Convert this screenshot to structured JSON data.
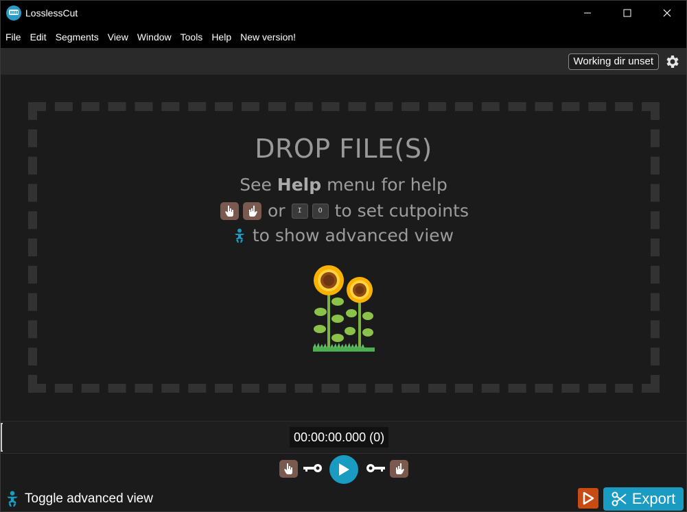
{
  "window": {
    "title": "LosslessCut",
    "minimize_icon": "minimize-icon",
    "maximize_icon": "maximize-icon",
    "close_icon": "close-icon"
  },
  "menu": [
    "File",
    "Edit",
    "Segments",
    "View",
    "Window",
    "Tools",
    "Help",
    "New version!"
  ],
  "topbar": {
    "working_dir_label": "Working dir unset",
    "settings_icon": "gear-icon"
  },
  "dropzone": {
    "title": "DROP FILE(S)",
    "help_prefix": "See",
    "help_bold": "Help",
    "help_suffix": "menu for help",
    "cut_or": "or",
    "key_in": "I",
    "key_out": "O",
    "cut_suffix": "to set cutpoints",
    "advanced_text": "to show advanced view"
  },
  "timeline": {
    "time": "00:00:00.000 (0)"
  },
  "bottom": {
    "toggle_advanced_label": "Toggle advanced view",
    "export_label": "Export"
  },
  "colors": {
    "accent": "#1a9bc2",
    "hand_button": "#7a5a4e",
    "render_button": "#c84b14"
  }
}
